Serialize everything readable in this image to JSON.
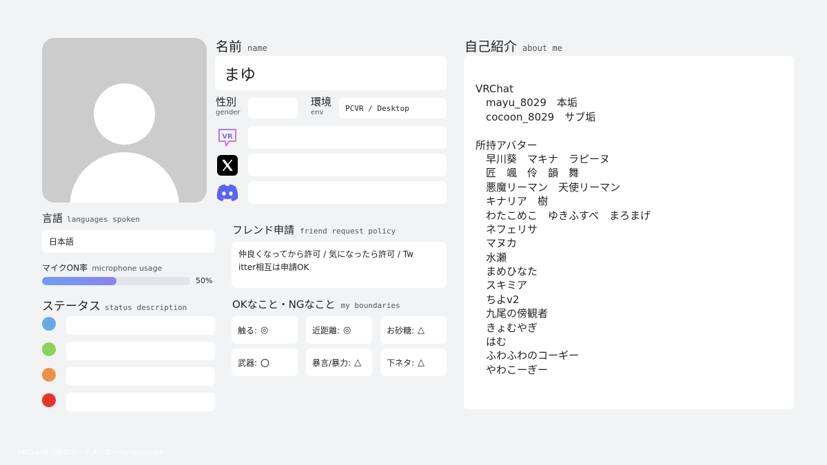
{
  "profile": {
    "name_label_jp": "名前",
    "name_label_en": "name",
    "name_value": "まゆ",
    "gender_label_jp": "性別",
    "gender_label_en": "gender",
    "gender_value": "",
    "env_label_jp": "環境",
    "env_label_en": "env",
    "env_value": "PCVR / Desktop",
    "sns": [
      {
        "icon": "vrchat-icon",
        "value": ""
      },
      {
        "icon": "x-twitter-icon",
        "value": ""
      },
      {
        "icon": "discord-icon",
        "value": ""
      }
    ]
  },
  "languages": {
    "label_jp": "言語",
    "label_en": "languages spoken",
    "value": "日本語"
  },
  "mic": {
    "label_jp": "マイクON率",
    "label_en": "microphone usage",
    "percent": 50,
    "percent_text": "50%"
  },
  "status": {
    "label_jp": "ステータス",
    "label_en": "status description",
    "items": [
      {
        "color": "#6aa9e8",
        "text": ""
      },
      {
        "color": "#8bd35b",
        "text": ""
      },
      {
        "color": "#ee9150",
        "text": ""
      },
      {
        "color": "#e8352b",
        "text": ""
      }
    ]
  },
  "friend": {
    "label_jp": "フレンド申請",
    "label_en": "friend request policy",
    "line1": "仲良くなってから許可 / 気になったら許可 / Tw",
    "line2": "itter相互は申請OK"
  },
  "boundaries": {
    "label_jp": "OKなこと・NGなこと",
    "label_en": "my boundaries",
    "cells": [
      {
        "label": "触る:",
        "mark": "◎"
      },
      {
        "label": "近距離:",
        "mark": "◎"
      },
      {
        "label": "お砂糖:",
        "mark": "△"
      },
      {
        "label": "武器:",
        "mark": "〇"
      },
      {
        "label": "暴言/暴力:",
        "mark": "△"
      },
      {
        "label": "下ネタ:",
        "mark": "△"
      }
    ]
  },
  "about": {
    "label_jp": "自己紹介",
    "label_en": "about me",
    "lines": [
      {
        "text": "VRChat",
        "indent": false
      },
      {
        "text": "mayu_8029　本垢",
        "indent": true
      },
      {
        "text": "cocoon_8029　サブ垢",
        "indent": true
      },
      {
        "text": "",
        "indent": false
      },
      {
        "text": "所持アバター",
        "indent": false
      },
      {
        "text": "早川葵　マキナ　ラピーヌ",
        "indent": true
      },
      {
        "text": "匠　颯　伶　韻　舞",
        "indent": true
      },
      {
        "text": "悪魔リーマン　天使リーマン",
        "indent": true
      },
      {
        "text": "キナリア　樹",
        "indent": true
      },
      {
        "text": "わたこめこ　ゆきふすべ　まろまげ",
        "indent": true
      },
      {
        "text": "ネフェリサ",
        "indent": true
      },
      {
        "text": "マヌカ",
        "indent": true
      },
      {
        "text": "水瀬",
        "indent": true
      },
      {
        "text": "まめひなた",
        "indent": true
      },
      {
        "text": "スキミア",
        "indent": true
      },
      {
        "text": "ちよv2",
        "indent": true
      },
      {
        "text": "九尾の傍観者",
        "indent": true
      },
      {
        "text": "きょむやぎ",
        "indent": true
      },
      {
        "text": "はむ",
        "indent": true
      },
      {
        "text": "ふわふわのコーギー",
        "indent": true
      },
      {
        "text": "やわこーぎー",
        "indent": true
      }
    ]
  },
  "footer": "VRChat自己紹介カードメーカー by @yota3d"
}
